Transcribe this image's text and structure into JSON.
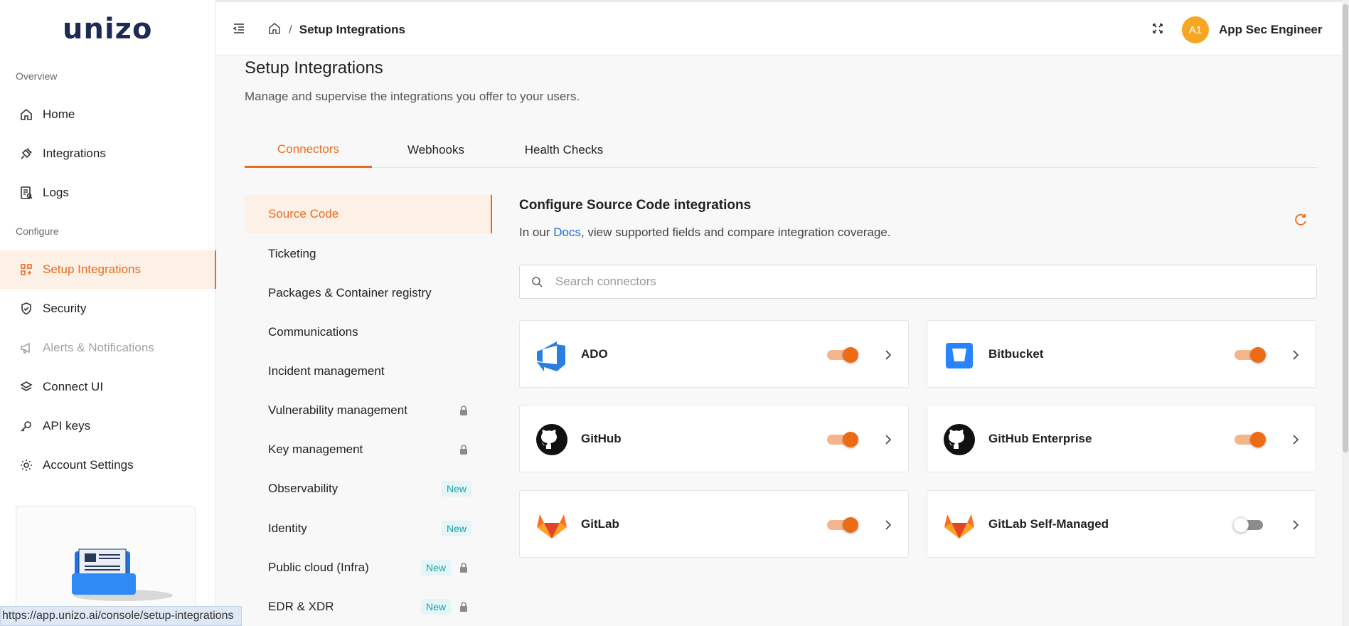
{
  "app": {
    "logo": "unizo"
  },
  "sidebar": {
    "sections": [
      {
        "label": "Overview"
      },
      {
        "label": "Configure"
      }
    ],
    "items": [
      {
        "label": "Home",
        "icon": "home-icon"
      },
      {
        "label": "Integrations",
        "icon": "plug-icon"
      },
      {
        "label": "Logs",
        "icon": "log-icon"
      },
      {
        "label": "Setup Integrations",
        "icon": "grid-icon",
        "active": true
      },
      {
        "label": "Security",
        "icon": "shield-icon"
      },
      {
        "label": "Alerts & Notifications",
        "icon": "megaphone-icon",
        "disabled": true
      },
      {
        "label": "Connect UI",
        "icon": "layers-icon"
      },
      {
        "label": "API keys",
        "icon": "key-icon"
      },
      {
        "label": "Account Settings",
        "icon": "gear-icon"
      }
    ]
  },
  "header": {
    "breadcrumb_current": "Setup Integrations",
    "avatar_initials": "A1",
    "user_name": "App Sec Engineer"
  },
  "main": {
    "title": "Setup Integrations",
    "subtitle": "Manage and supervise the integrations you offer to your users.",
    "tabs": [
      {
        "label": "Connectors",
        "active": true
      },
      {
        "label": "Webhooks"
      },
      {
        "label": "Health Checks"
      }
    ],
    "categories": [
      {
        "label": "Source Code",
        "active": true
      },
      {
        "label": "Ticketing"
      },
      {
        "label": "Packages & Container registry"
      },
      {
        "label": "Communications"
      },
      {
        "label": "Incident management"
      },
      {
        "label": "Vulnerability management",
        "locked": true
      },
      {
        "label": "Key management",
        "locked": true
      },
      {
        "label": "Observability",
        "badge": "New"
      },
      {
        "label": "Identity",
        "badge": "New"
      },
      {
        "label": "Public cloud (Infra)",
        "badge": "New",
        "locked": true
      },
      {
        "label": "EDR & XDR",
        "badge": "New",
        "locked": true
      }
    ],
    "config": {
      "title": "Configure Source Code integrations",
      "desc_prefix": "In our ",
      "docs_link": "Docs",
      "desc_suffix": ", view supported fields and compare integration coverage.",
      "search_placeholder": "Search connectors"
    },
    "connectors": [
      {
        "name": "ADO",
        "icon": "azure-devops-icon",
        "enabled": true
      },
      {
        "name": "Bitbucket",
        "icon": "bitbucket-icon",
        "enabled": true
      },
      {
        "name": "GitHub",
        "icon": "github-icon",
        "enabled": true
      },
      {
        "name": "GitHub Enterprise",
        "icon": "github-icon",
        "enabled": true
      },
      {
        "name": "GitLab",
        "icon": "gitlab-icon",
        "enabled": true
      },
      {
        "name": "GitLab Self-Managed",
        "icon": "gitlab-icon",
        "enabled": false
      }
    ]
  },
  "status_bar": {
    "url": "https://app.unizo.ai/console/setup-integrations"
  },
  "colors": {
    "accent": "#e86c1f",
    "new_badge": "#1aa0a8",
    "link": "#1f6fd1"
  }
}
